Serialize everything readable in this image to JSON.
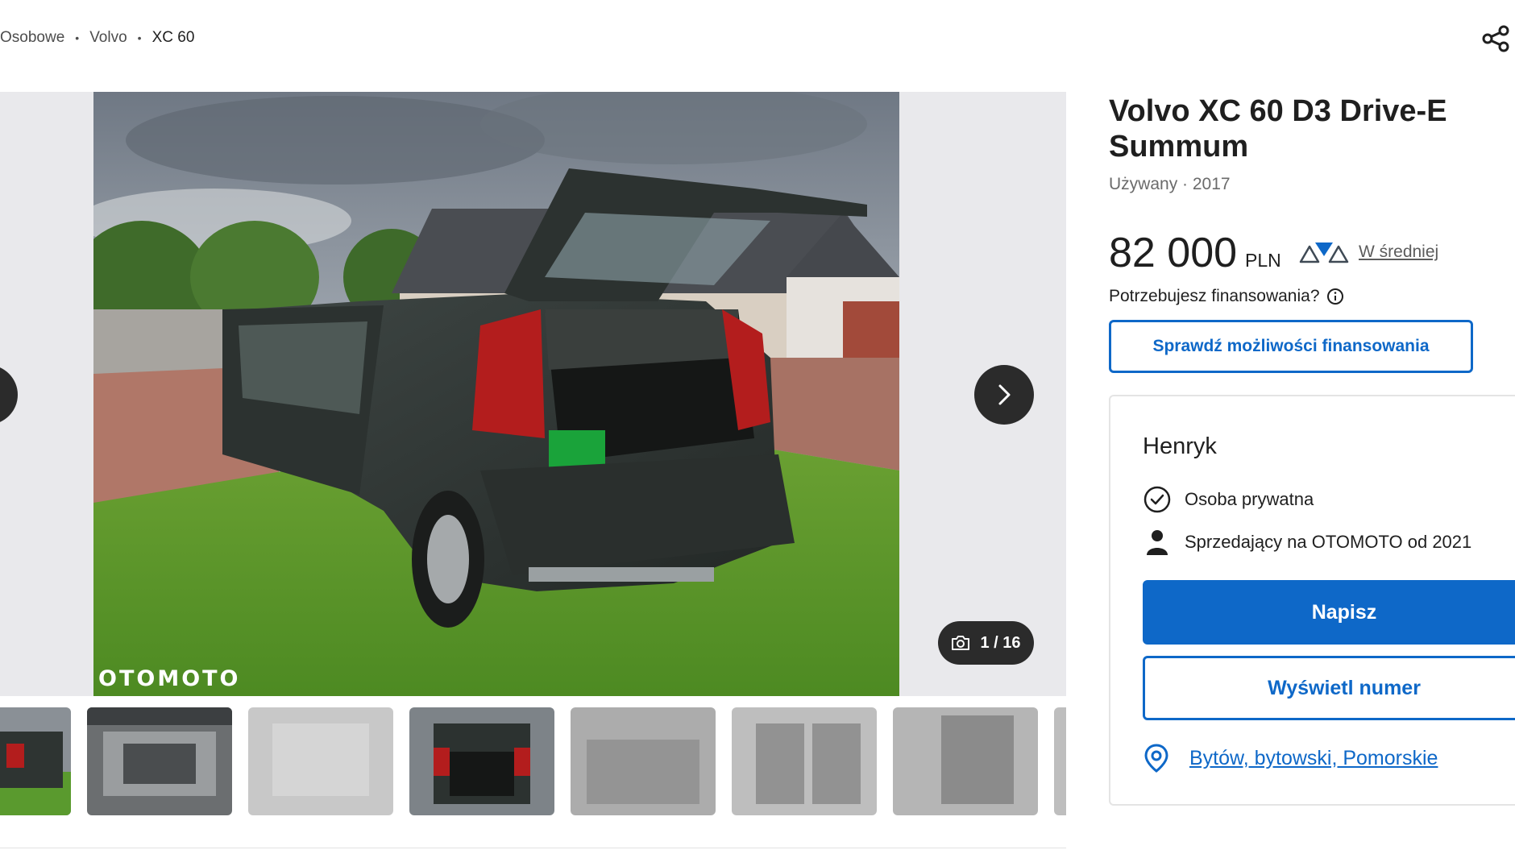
{
  "breadcrumb": {
    "items": [
      "Osobowe",
      "Volvo",
      "XC 60"
    ],
    "separator": "•"
  },
  "gallery": {
    "watermark": "OTOMOTO",
    "counter": "1 / 16",
    "thumbnail_count": 7
  },
  "listing": {
    "title": "Volvo XC 60 D3 Drive-E Summum",
    "meta": "Używany · 2017",
    "price": "82 000",
    "currency": "PLN",
    "price_evaluation": "W średniej",
    "finance_question": "Potrzebujesz finansowania?",
    "finance_button": "Sprawdź możliwości finansowania"
  },
  "seller": {
    "name": "Henryk",
    "type": "Osoba prywatna",
    "since": "Sprzedający na OTOMOTO od 2021",
    "write_button": "Napisz",
    "phone_button": "Wyświetl numer",
    "location": "Bytów, bytowski, Pomorskie"
  },
  "colors": {
    "accent": "#0e68c8",
    "dark_control": "#2b2b2b",
    "gallery_bg": "#e9e9ec"
  }
}
